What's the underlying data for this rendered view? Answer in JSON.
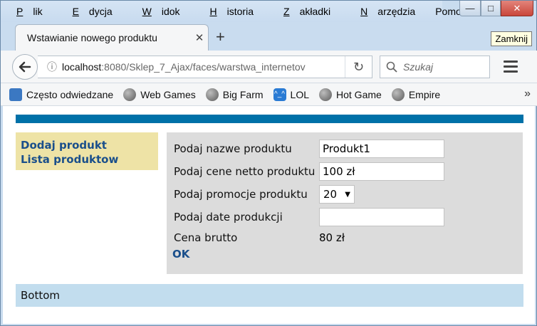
{
  "menu": [
    "Plik",
    "Edycja",
    "Widok",
    "Historia",
    "Zakładki",
    "Narzędzia",
    "Pomoc"
  ],
  "menu_underline": [
    "P",
    "E",
    "W",
    "H",
    "Z",
    "N",
    "c"
  ],
  "window": {
    "tooltip": "Zamknij"
  },
  "tab": {
    "title": "Wstawianie nowego produktu"
  },
  "navbar": {
    "url_host": "localhost",
    "url_rest": ":8080/Sklep_7_Ajax/faces/warstwa_internetov",
    "search_placeholder": "Szukaj"
  },
  "bookmarks": [
    "Często odwiedzane",
    "Web Games",
    "Big Farm",
    "LOL",
    "Hot Game",
    "Empire"
  ],
  "bookmark_icons": [
    "search-page-icon",
    "globe-icon",
    "globe-icon",
    "lol-icon",
    "globe-icon",
    "globe-icon"
  ],
  "sidebar": {
    "links": [
      "Dodaj produkt",
      "Lista produktow"
    ]
  },
  "form": {
    "name_label": "Podaj nazwe produktu",
    "name_value": "Produkt1",
    "price_label": "Podaj cene netto produktu",
    "price_value": "100 zł",
    "promo_label": "Podaj promocje produktu",
    "promo_value": "20",
    "date_label": "Podaj date produkcji",
    "date_value": "",
    "gross_label": "Cena brutto",
    "gross_value": "80 zł",
    "ok_label": "OK"
  },
  "footer": {
    "text": "Bottom"
  },
  "colors": {
    "stripe": "#0071a8",
    "sidebar_bg": "#eee3a6",
    "link": "#1a4f8b",
    "panel_bg": "#dcdcdc",
    "footer_bg": "#c2ddee"
  }
}
